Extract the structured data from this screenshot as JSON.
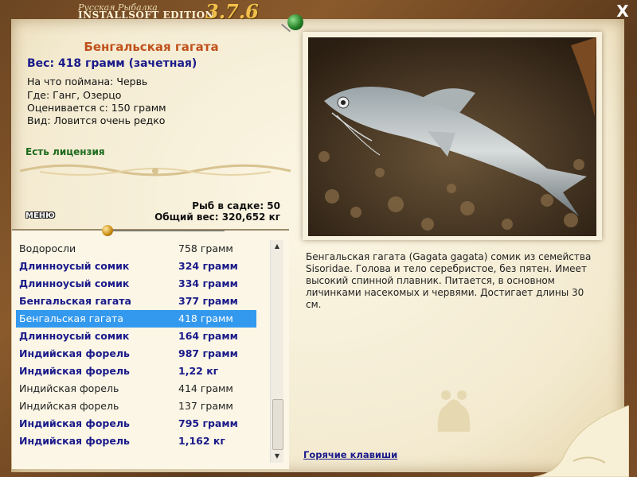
{
  "app": {
    "logo_small": "Русская Рыбалка",
    "logo_main": "INSTALLSOFT EDITION",
    "logo_version": "3.7.6",
    "close_glyph": "X"
  },
  "fish": {
    "name": "Бенгальская гагата",
    "weight": "Вес: 418 грамм (зачетная)",
    "caught_on": "На что поймана: Червь",
    "where": "Где: Ганг, Озерцо",
    "rated_from": "Оценивается с: 150 грамм",
    "kind": "Вид: Ловится очень редко",
    "license": "Есть лицензия",
    "description": "Бенгальская гагата (Gagata gagata) сомик из семейства Sisoridae. Голова и тело серебристое, без пятен. Имеет высокий спинной плавник. Питается, в основном личинками насекомых и червями. Достигает длины 30 см."
  },
  "stats": {
    "in_cage": "Рыб в садке: 50",
    "total_weight": "Общий вес: 320,652 кг"
  },
  "menu_label": "МЕНЮ",
  "hotkeys_link": "Горячие клавиши",
  "catch_list": [
    {
      "name": "Водоросли",
      "weight": "758 грамм",
      "style": "plain"
    },
    {
      "name": "Длинноусый сомик",
      "weight": "324 грамм",
      "style": "bold"
    },
    {
      "name": "Длинноусый сомик",
      "weight": "334 грамм",
      "style": "bold"
    },
    {
      "name": "Бенгальская гагата",
      "weight": "377 грамм",
      "style": "bold"
    },
    {
      "name": "Бенгальская гагата",
      "weight": "418 грамм",
      "style": "sel"
    },
    {
      "name": "Длинноусый сомик",
      "weight": "164 грамм",
      "style": "bold"
    },
    {
      "name": "Индийская форель",
      "weight": "987 грамм",
      "style": "bold"
    },
    {
      "name": "Индийская форель",
      "weight": "1,22 кг",
      "style": "bold"
    },
    {
      "name": "Индийская форель",
      "weight": "414 грамм",
      "style": "plain"
    },
    {
      "name": "Индийская форель",
      "weight": "137 грамм",
      "style": "plain"
    },
    {
      "name": "Индийская форель",
      "weight": "795 грамм",
      "style": "bold"
    },
    {
      "name": "Индийская форель",
      "weight": "1,162 кг",
      "style": "bold"
    }
  ],
  "colors": {
    "title_orange": "#c0521c",
    "weight_blue": "#1a1a8a",
    "license_green": "#1c6a1c",
    "selection_blue": "#3399ee"
  },
  "icons": {
    "close": "close-icon",
    "pin": "pin-icon",
    "bobber": "bobber-icon",
    "scroll_up": "scroll-up-icon",
    "scroll_down": "scroll-down-icon"
  }
}
